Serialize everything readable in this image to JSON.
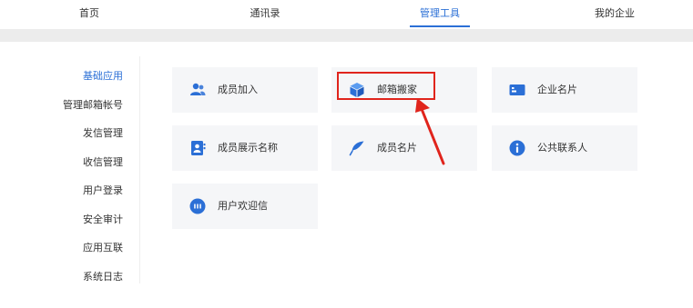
{
  "nav": {
    "tabs": [
      {
        "label": "首页"
      },
      {
        "label": "通讯录"
      },
      {
        "label": "管理工具"
      },
      {
        "label": "我的企业"
      }
    ]
  },
  "sidebar": {
    "items": [
      {
        "label": "基础应用"
      },
      {
        "label": "管理邮箱帐号"
      },
      {
        "label": "发信管理"
      },
      {
        "label": "收信管理"
      },
      {
        "label": "用户登录"
      },
      {
        "label": "安全审计"
      },
      {
        "label": "应用互联"
      },
      {
        "label": "系统日志"
      }
    ]
  },
  "cards": [
    {
      "label": "成员加入",
      "icon": "users-icon"
    },
    {
      "label": "邮箱搬家",
      "icon": "box-icon"
    },
    {
      "label": "企业名片",
      "icon": "card-icon"
    },
    {
      "label": "成员展示名称",
      "icon": "contact-icon"
    },
    {
      "label": "成员名片",
      "icon": "feather-icon"
    },
    {
      "label": "公共联系人",
      "icon": "info-icon"
    },
    {
      "label": "用户欢迎信",
      "icon": "chat-icon"
    }
  ],
  "colors": {
    "accent": "#2b6fd6",
    "highlight": "#e0241c",
    "card_bg": "#f5f6f8"
  }
}
